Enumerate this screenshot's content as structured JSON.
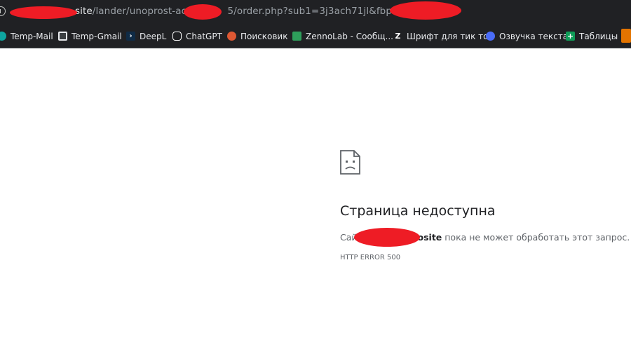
{
  "browser": {
    "url_host_suffix": "site",
    "url_path": "/lander/unoprost-ao_1",
    "url_path_tail": "5/order.php?sub1=3j3ach71jl&fbpixel=79",
    "redaction_color": "#ee1c25"
  },
  "bookmarks": [
    {
      "label": "Temp-Mail",
      "icon": "temp-mail-icon",
      "color": "#0ea5a0"
    },
    {
      "label": "Temp-Gmail",
      "icon": "temp-gmail-icon",
      "color": "#3c4043"
    },
    {
      "label": "DeepL",
      "icon": "deepl-icon",
      "color": "#0f2b46"
    },
    {
      "label": "ChatGPT",
      "icon": "chatgpt-icon",
      "color": "#ffffff"
    },
    {
      "label": "Поисковик",
      "icon": "duckduckgo-icon",
      "color": "#de5833"
    },
    {
      "label": "ZennoLab - Сообщ...",
      "icon": "zennolab-icon",
      "color": "#2e9e5b"
    },
    {
      "label": "Шрифт для тик ток",
      "icon": "tiktok-font-icon",
      "color": "#ffffff"
    },
    {
      "label": "Озвучка текста",
      "icon": "voice-icon",
      "color": "#4a6cf7"
    },
    {
      "label": "Таблицы",
      "icon": "sheets-icon",
      "color": "#0f9d58"
    }
  ],
  "error_page": {
    "title": "Страница недоступна",
    "desc_prefix": "Сай",
    "desc_host": "osite",
    "desc_suffix": " пока не может обработать этот запрос.",
    "error_code": "HTTP ERROR 500",
    "icon": "broken-page-icon"
  }
}
